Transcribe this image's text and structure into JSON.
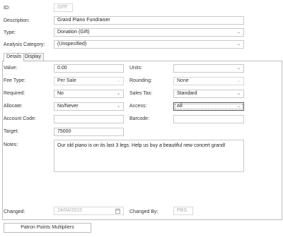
{
  "header": {
    "id_label": "ID:",
    "id_value": "GPF",
    "description_label": "Description:",
    "description_value": "Grand Piano Fundraiser",
    "type_label": "Type:",
    "type_value": "Donation (Gift)",
    "analysis_label": "Analysis Category:",
    "analysis_value": "(Unspecified)"
  },
  "tabs": [
    {
      "label": "Details",
      "active": true
    },
    {
      "label": "Display",
      "active": false
    }
  ],
  "details": {
    "value_label": "Value:",
    "value_value": "0.00",
    "units_label": "Units:",
    "units_value": "",
    "fee_type_label": "Fee Type:",
    "fee_type_value": "Per Sale",
    "rounding_label": "Rounding:",
    "rounding_value": "None",
    "required_label": "Required:",
    "required_value": "No",
    "sales_tax_label": "Sales Tax:",
    "sales_tax_value": "Standard",
    "allocate_label": "Allocate:",
    "allocate_value": "No/Never",
    "access_label": "Access:",
    "access_value": "All",
    "account_code_label": "Account Code:",
    "account_code_value": "",
    "barcode_label": "Barcode:",
    "barcode_value": "",
    "target_label": "Target:",
    "target_value": "75000",
    "notes_label": "Notes:",
    "notes_value": "Our old piano is on its last 3 legs. Help us buy a beautiful new concert grand!",
    "changed_label": "Changed:",
    "changed_value": "24/04/2015",
    "changed_by_label": "Changed By:",
    "changed_by_value": "PBS"
  },
  "buttons": {
    "patron_points": "Patron Points Multipliers"
  },
  "icons": {
    "chevron": "chevron-down-icon",
    "calendar": "calendar-icon"
  }
}
